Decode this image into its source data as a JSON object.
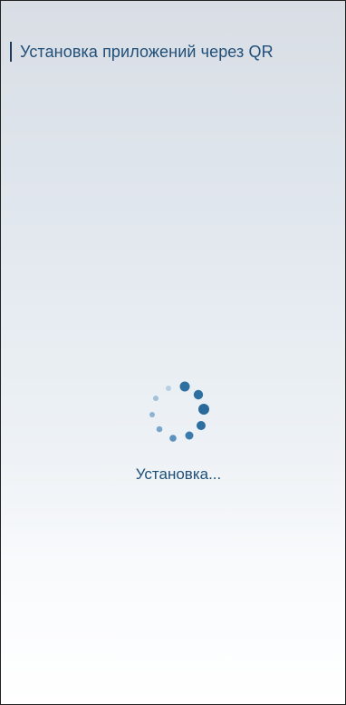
{
  "title": "Установка приложений через QR",
  "status": "Установка...",
  "spinner": {
    "icon": "loading-spinner-icon",
    "color": "#2c6fa0"
  }
}
